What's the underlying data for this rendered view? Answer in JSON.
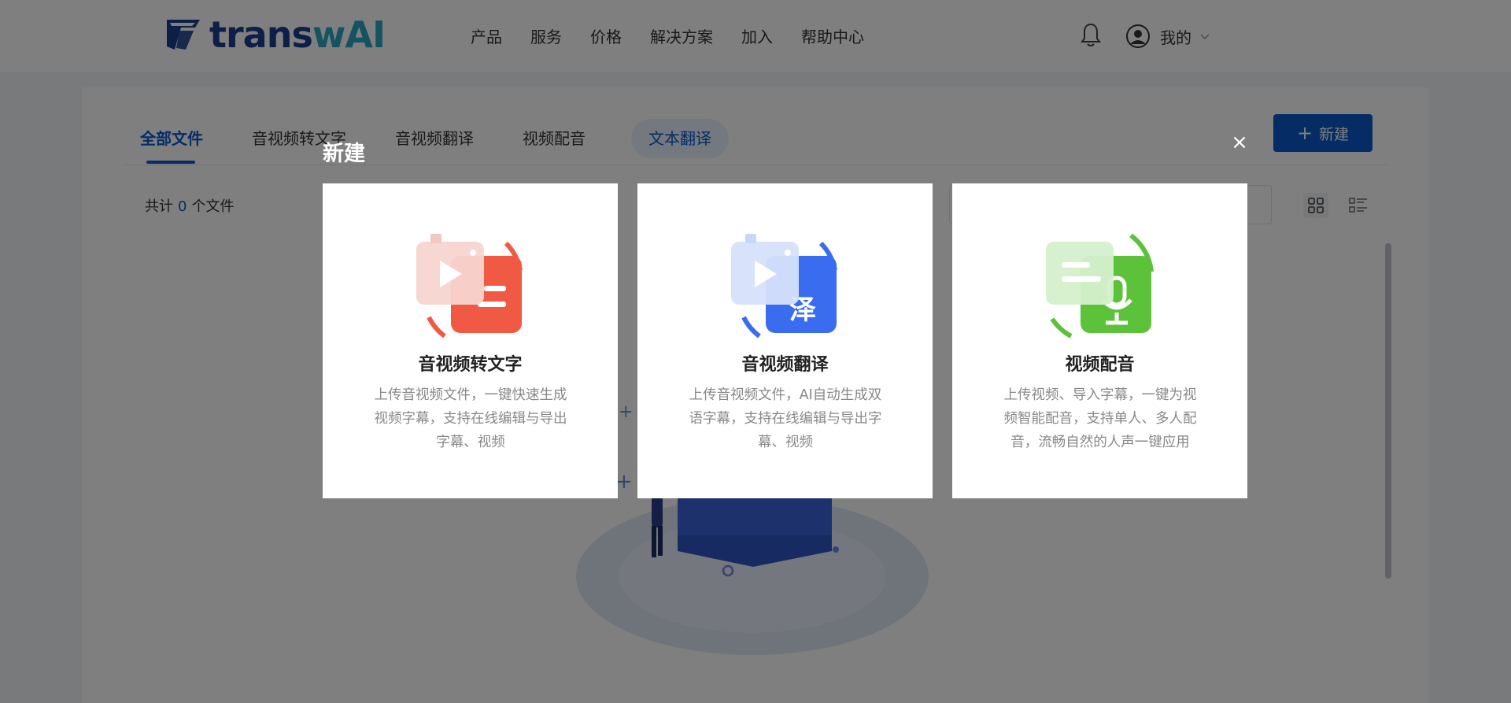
{
  "brand": {
    "part1": "trans",
    "part2": "wAI"
  },
  "nav": [
    "产品",
    "服务",
    "价格",
    "解决方案",
    "加入",
    "帮助中心"
  ],
  "user": {
    "label": "我的"
  },
  "tabs": [
    {
      "label": "全部文件",
      "active": true
    },
    {
      "label": "音视频转文字"
    },
    {
      "label": "音视频翻译"
    },
    {
      "label": "视频配音"
    },
    {
      "label": "文本翻译"
    }
  ],
  "toolbar": {
    "new_button": "新建"
  },
  "file_count": {
    "prefix": "共计",
    "count": "0",
    "suffix": "个文件"
  },
  "modal": {
    "title": "新建",
    "close": "×",
    "cards": [
      {
        "title": "音视频转文字",
        "desc": "上传音视频文件，一键快速生成视频字幕，支持在线编辑与导出字幕、视频",
        "icon": "video-to-text-icon"
      },
      {
        "title": "音视频翻译",
        "desc": "上传音视频文件，AI自动生成双语字幕，支持在线编辑与导出字幕、视频",
        "icon": "video-translate-icon"
      },
      {
        "title": "视频配音",
        "desc": "上传视频、导入字幕，一键为视频智能配音，支持单人、多人配音，流畅自然的人声一键应用",
        "icon": "video-dubbing-icon"
      }
    ]
  },
  "colors": {
    "accent": "#0a58ca",
    "red": "#f05a44",
    "blue": "#3a6cf0",
    "green": "#5cc23a"
  }
}
